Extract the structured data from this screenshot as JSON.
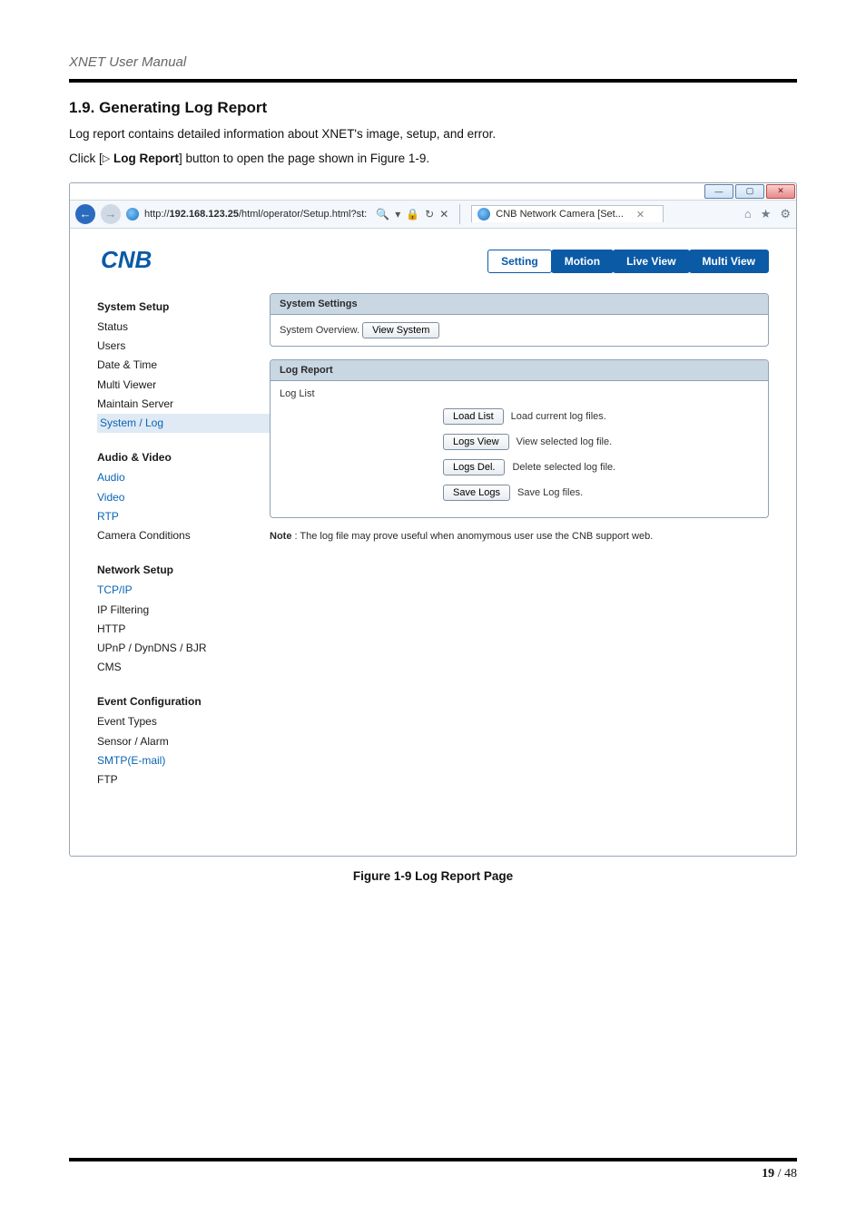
{
  "doc": {
    "title": "XNET User Manual",
    "section_heading": "1.9. Generating Log Report",
    "para1": "Log report contains detailed information about XNET's image, setup, and error.",
    "para2_pre": "Click [",
    "para2_btn": "Log Report",
    "para2_post": "] button to open the page shown in Figure 1-9.",
    "figure_caption": "Figure 1-9 Log Report Page",
    "page_current": "19",
    "page_sep": " / ",
    "page_total": "48"
  },
  "window": {
    "controls": {
      "min": "—",
      "max": "▢",
      "close": "✕"
    },
    "url_prefix": "http://",
    "url_host": "192.168.123.25",
    "url_path": "/html/operator/Setup.html?st:",
    "addr_icons": {
      "search": "🔍",
      "dropdown": "▾",
      "lock": "🔒",
      "refresh": "↻",
      "stop": "✕"
    },
    "tab_title": "CNB Network Camera [Set...",
    "tab_close": "✕",
    "right_tools": {
      "home": "⌂",
      "star": "★",
      "gear": "⚙"
    }
  },
  "logo_text": "CNB",
  "topnav": {
    "setting": "Setting",
    "motion": "Motion",
    "liveview": "Live View",
    "multiview": "Multi View"
  },
  "sidebar": {
    "g1": {
      "title": "System Setup",
      "items": [
        "Status",
        "Users",
        "Date & Time",
        "Multi Viewer",
        "Maintain Server",
        "System / Log"
      ]
    },
    "g2": {
      "title": "Audio & Video",
      "items": [
        "Audio",
        "Video",
        "RTP",
        "Camera Conditions"
      ]
    },
    "g3": {
      "title": "Network Setup",
      "items": [
        "TCP/IP",
        "IP Filtering",
        "HTTP",
        "UPnP / DynDNS / BJR",
        "CMS"
      ]
    },
    "g4": {
      "title": "Event Configuration",
      "items": [
        "Event Types",
        "Sensor / Alarm",
        "SMTP(E-mail)",
        "FTP"
      ]
    }
  },
  "panel1": {
    "title": "System Settings",
    "row_label": "System Overview.",
    "btn": "View System"
  },
  "panel2": {
    "title": "Log Report",
    "subtitle": "Log List",
    "rows": [
      {
        "btn": "Load List",
        "text": "Load current log files."
      },
      {
        "btn": "Logs View",
        "text": "View selected log file."
      },
      {
        "btn": "Logs Del.",
        "text": "Delete selected log file."
      },
      {
        "btn": "Save Logs",
        "text": "Save Log files."
      }
    ]
  },
  "note": {
    "label": "Note",
    "text": " : The log file may prove useful when anomymous user use the CNB support web."
  }
}
